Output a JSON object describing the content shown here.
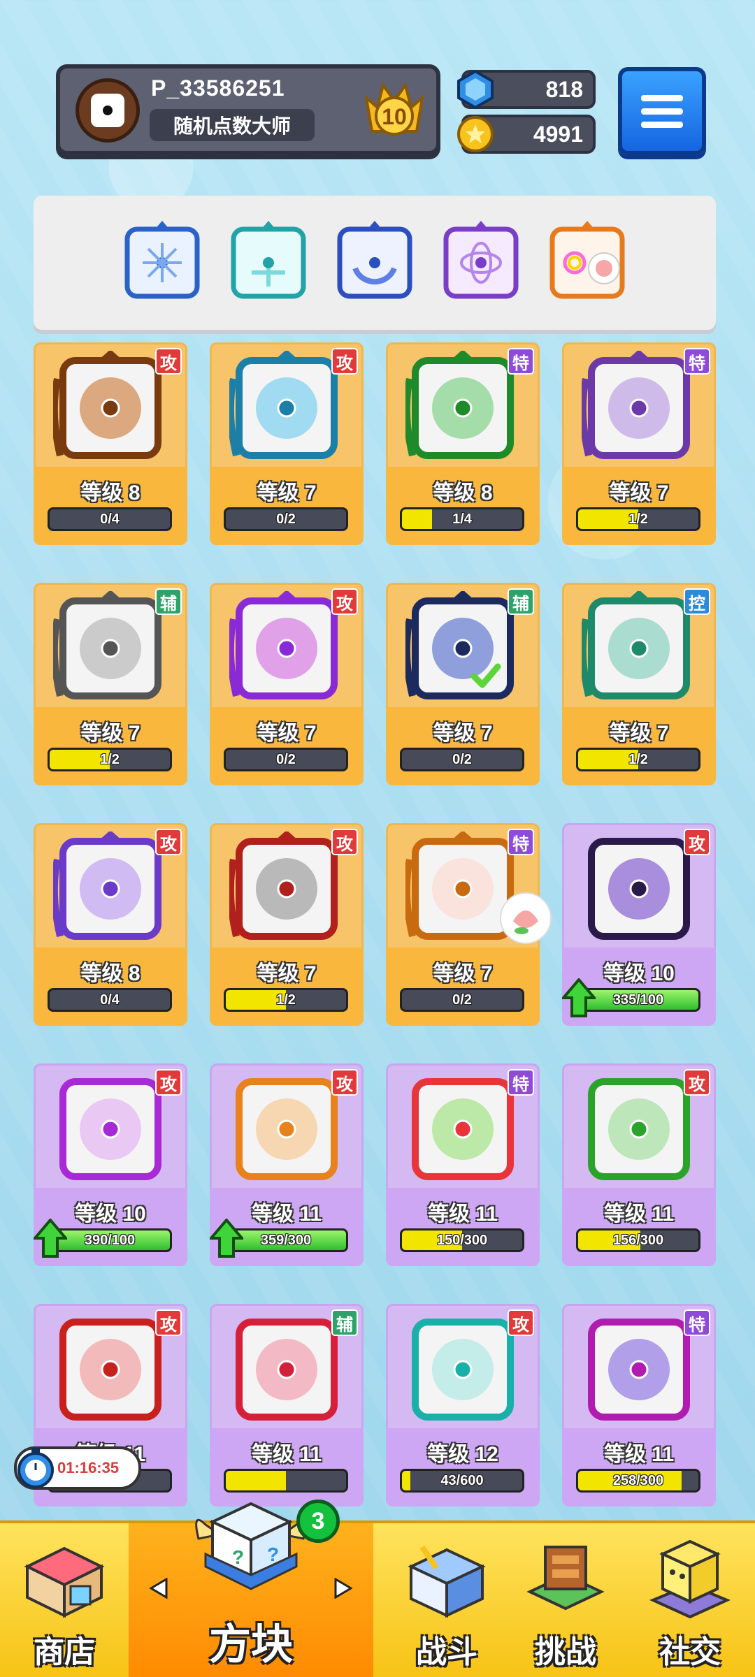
{
  "header": {
    "player_id": "P_33586251",
    "player_title": "随机点数大师",
    "rank": "10",
    "gems": "818",
    "coins": "4991"
  },
  "deck": {
    "slots": [
      "snowflake-dice-icon",
      "totem-dice-icon",
      "moon-dice-icon",
      "arcane-dice-icon",
      "rainbow-dice-icon"
    ]
  },
  "cards": [
    {
      "name": "gun",
      "style": "orange",
      "tag": "攻",
      "level": "等级 8",
      "progress": "0/4",
      "fill": 0.0
    },
    {
      "name": "wind",
      "style": "orange",
      "tag": "攻",
      "level": "等级 7",
      "progress": "0/2",
      "fill": 0.0
    },
    {
      "name": "growth",
      "style": "orange",
      "tag": "特",
      "level": "等级 8",
      "progress": "1/4",
      "fill": 0.25
    },
    {
      "name": "shadow",
      "style": "orange",
      "tag": "特",
      "level": "等级 7",
      "progress": "1/2",
      "fill": 0.5
    },
    {
      "name": "time",
      "style": "orange",
      "tag": "辅",
      "level": "等级 7",
      "progress": "1/2",
      "fill": 0.5
    },
    {
      "name": "combo",
      "style": "orange",
      "tag": "攻",
      "level": "等级 7",
      "progress": "0/2",
      "fill": 0.0
    },
    {
      "name": "crescent",
      "style": "orange",
      "tag": "辅",
      "level": "等级 7",
      "progress": "0/2",
      "fill": 0.0
    },
    {
      "name": "wave",
      "style": "orange",
      "tag": "控",
      "level": "等级 7",
      "progress": "1/2",
      "fill": 0.5
    },
    {
      "name": "star",
      "style": "orange",
      "tag": "攻",
      "level": "等级 8",
      "progress": "0/4",
      "fill": 0.0
    },
    {
      "name": "saw",
      "style": "orange",
      "tag": "攻",
      "level": "等级 7",
      "progress": "1/2",
      "fill": 0.5
    },
    {
      "name": "heart",
      "style": "orange",
      "tag": "特",
      "level": "等级 7",
      "progress": "0/2",
      "fill": 0.0
    },
    {
      "name": "reaper",
      "style": "purple",
      "tag": "攻",
      "level": "等级 10",
      "progress": "335/100",
      "fill": 1.0
    },
    {
      "name": "pixel",
      "style": "purple",
      "tag": "攻",
      "level": "等级 10",
      "progress": "390/100",
      "fill": 1.0
    },
    {
      "name": "target",
      "style": "purple",
      "tag": "攻",
      "level": "等级 11",
      "progress": "359/300",
      "fill": 1.0
    },
    {
      "name": "prism",
      "style": "purple",
      "tag": "特",
      "level": "等级 11",
      "progress": "150/300",
      "fill": 0.5
    },
    {
      "name": "biohazard",
      "style": "purple",
      "tag": "攻",
      "level": "等级 11",
      "progress": "156/300",
      "fill": 0.52
    },
    {
      "name": "lightning",
      "style": "purple",
      "tag": "攻",
      "level": "等级 11",
      "progress": "",
      "fill": 0.0
    },
    {
      "name": "cross",
      "style": "purple",
      "tag": "辅",
      "level": "等级 11",
      "progress": "",
      "fill": 0.5
    },
    {
      "name": "swirl",
      "style": "purple",
      "tag": "攻",
      "level": "等级 12",
      "progress": "43/600",
      "fill": 0.07
    },
    {
      "name": "arrows",
      "style": "purple",
      "tag": "特",
      "level": "等级 11",
      "progress": "258/300",
      "fill": 0.86
    }
  ],
  "timer": "01:16:35",
  "nav": {
    "shop": "商店",
    "dice": "方块",
    "battle": "战斗",
    "challenge": "挑战",
    "social": "社交",
    "dice_badge": "3"
  },
  "colors": {
    "attack_tag": "#e23a3a",
    "special_tag": "#8f4ad9",
    "support_tag": "#2ba36a",
    "control_tag": "#2b8ad9",
    "progress_yellow": "#f2e500",
    "progress_green": "#2fbf2f"
  }
}
